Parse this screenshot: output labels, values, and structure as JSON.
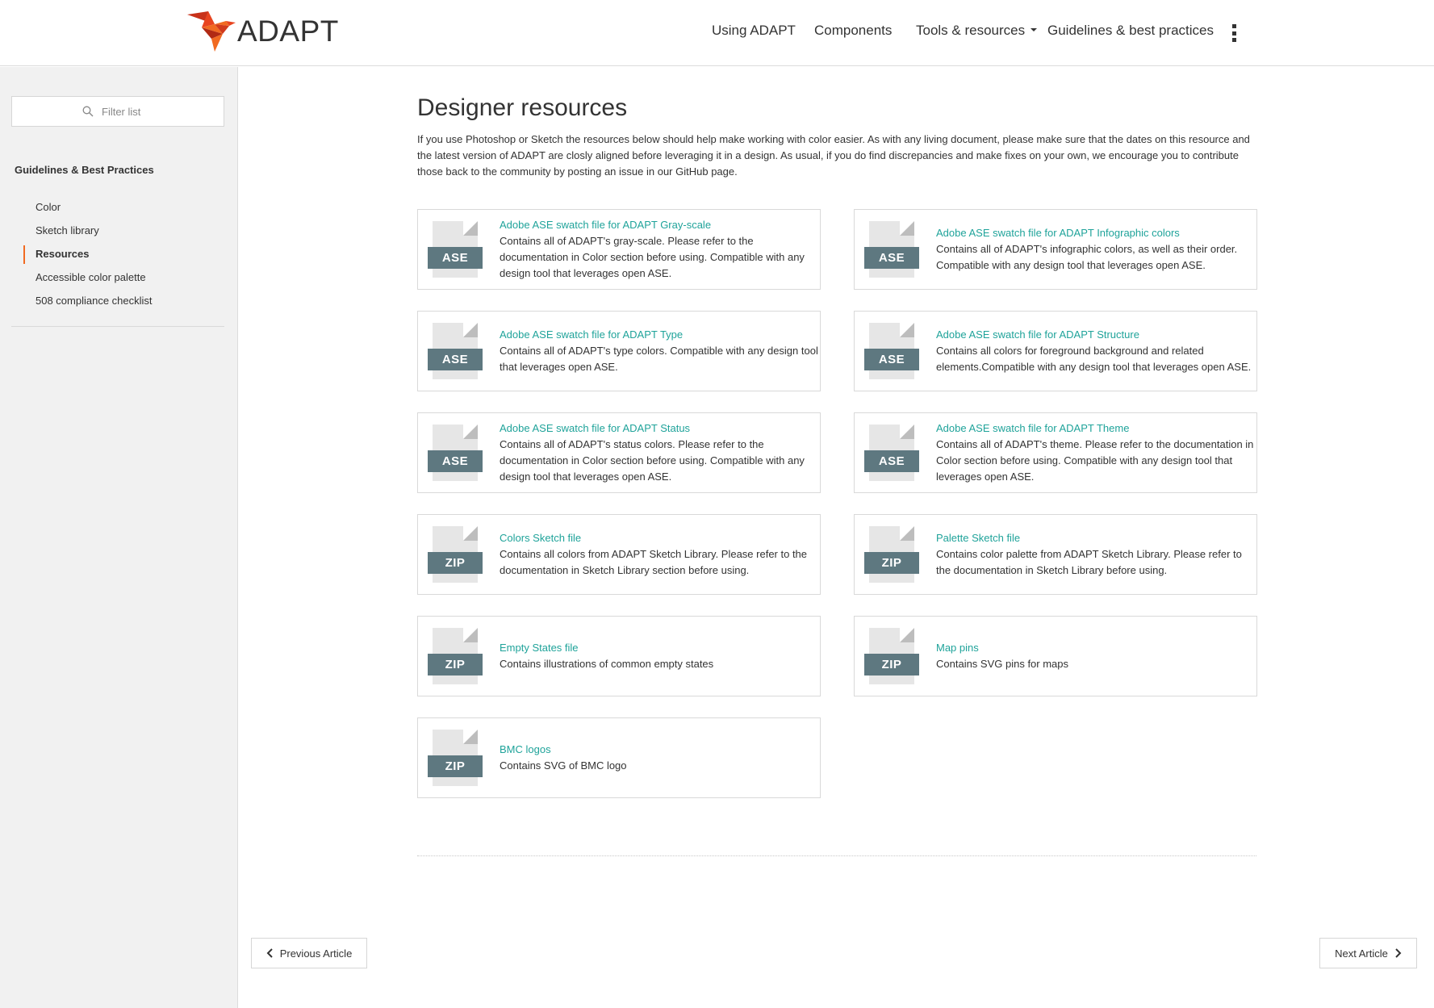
{
  "header": {
    "logo_text": "ADAPT",
    "logo_icon": "origami-bird-icon",
    "brand_color": "#f16a21",
    "nav": [
      {
        "label": "Using ADAPT"
      },
      {
        "label": "Components"
      },
      {
        "label": "Tools & resources",
        "has_dropdown": true
      },
      {
        "label": "Guidelines & best practices"
      }
    ],
    "more_icon": "kebab-menu-icon"
  },
  "sidebar": {
    "filter_placeholder": "Filter list",
    "filter_value": "",
    "section_heading": "Guidelines & Best Practices",
    "items": [
      {
        "label": "Color",
        "active": false
      },
      {
        "label": "Sketch library",
        "active": false
      },
      {
        "label": "Resources",
        "active": true
      },
      {
        "label": "Accessible color palette",
        "active": false
      },
      {
        "label": "508 compliance checklist",
        "active": false
      }
    ],
    "active_indicator_color": "#f16a21"
  },
  "main": {
    "title": "Designer resources",
    "intro": "If you use Photoshop or Sketch the resources below should help make working with color easier. As with any living document, please make sure that the dates on this resource and the latest version of ADAPT are closly aligned before leveraging it in a design. As usual, if you do find discrepancies and make fixes on your own, we encourage you to contribute those back to the community by posting an issue in our GitHub page.",
    "link_color": "#1fa39a",
    "file_badge_color": "#5e7880",
    "resources": [
      {
        "type": "ASE",
        "title": "Adobe ASE swatch file for ADAPT Gray-scale",
        "description": "Contains all of ADAPT's gray-scale. Please refer to the documentation in Color section before using. Compatible with any design tool that leverages open ASE."
      },
      {
        "type": "ASE",
        "title": "Adobe ASE swatch file for ADAPT Infographic colors",
        "description": "Contains all of ADAPT's infographic colors, as well as their order. Compatible with any design tool that leverages open ASE."
      },
      {
        "type": "ASE",
        "title": "Adobe ASE swatch file for ADAPT Type",
        "description": "Contains all of ADAPT's type colors. Compatible with any design tool that leverages open ASE."
      },
      {
        "type": "ASE",
        "title": "Adobe ASE swatch file for ADAPT Structure",
        "description": "Contains all colors for foreground background and related elements.Compatible with any design tool that leverages open ASE."
      },
      {
        "type": "ASE",
        "title": "Adobe ASE swatch file for ADAPT Status",
        "description": "Contains all of ADAPT's status colors. Please refer to the documentation in Color section before using. Compatible with any design tool that leverages open ASE."
      },
      {
        "type": "ASE",
        "title": "Adobe ASE swatch file for ADAPT Theme",
        "description": "Contains all of ADAPT's theme. Please refer to the documentation in Color section before using. Compatible with any design tool that leverages open ASE."
      },
      {
        "type": "ZIP",
        "title": "Colors Sketch file",
        "description": "Contains all colors from ADAPT Sketch Library. Please refer to the documentation in Sketch Library section before using."
      },
      {
        "type": "ZIP",
        "title": "Palette Sketch file",
        "description": "Contains color palette from ADAPT Sketch Library. Please refer to the documentation in Sketch Library before using."
      },
      {
        "type": "ZIP",
        "title": "Empty States file",
        "description": "Contains illustrations of common empty states"
      },
      {
        "type": "ZIP",
        "title": "Map pins",
        "description": "Contains SVG pins for maps"
      },
      {
        "type": "ZIP",
        "title": "BMC logos",
        "description": "Contains SVG of BMC logo"
      }
    ]
  },
  "footer": {
    "previous_label": "Previous Article",
    "next_label": "Next Article"
  }
}
